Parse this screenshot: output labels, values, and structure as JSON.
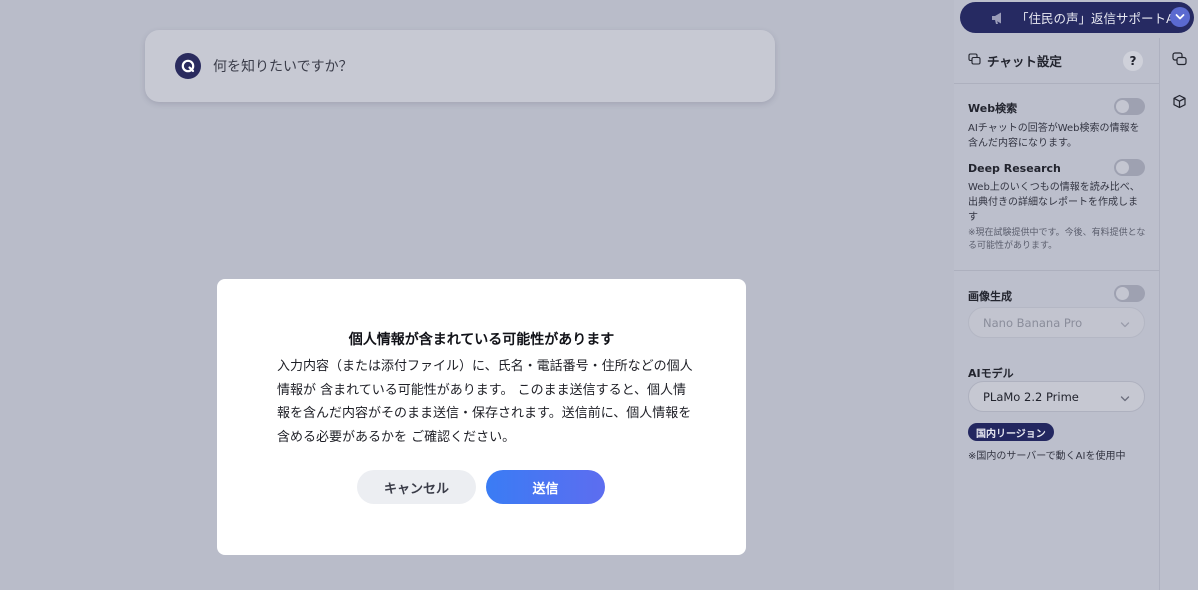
{
  "question_bar": {
    "placeholder": "何を知りたいですか？",
    "icon": "q-logo-icon"
  },
  "assistant": {
    "name": "「住民の声」返信サポートAI",
    "icon": "megaphone-icon",
    "chevron_icon": "chevron-down-icon"
  },
  "panel": {
    "title": "チャット設定",
    "title_icon": "chat-settings-icon",
    "help_label": "?",
    "side_icons": [
      "chat-bubbles-icon",
      "cube-icon"
    ],
    "web_search": {
      "label": "Web検索",
      "desc": "AIチャットの回答がWeb検索の情報を含んだ内容になります。",
      "enabled": false
    },
    "deep_research": {
      "label": "Deep Research",
      "desc": "Web上のいくつもの情報を読み比べ、出典付きの詳細なレポートを作成します",
      "note": "※現在試験提供中です。今後、有料提供となる可能性があります。",
      "enabled": false
    },
    "image_gen": {
      "label": "画像生成",
      "model": "Nano Banana Pro",
      "enabled": false
    },
    "ai_model": {
      "label": "AIモデル",
      "model": "PLaMo 2.2 Prime",
      "region_badge": "国内リージョン",
      "region_note": "※国内のサーバーで動くAIを使用中"
    }
  },
  "modal": {
    "title": "個人情報が含まれている可能性があります",
    "body": "入力内容（または添付ファイル）に、氏名・電話番号・住所などの個人情報が 含まれている可能性があります。 このまま送信すると、個人情報を含んだ内容がそのまま送信・保存されます。送信前に、個人情報を含める必要があるかを ご確認ください。",
    "cancel_label": "キャンセル",
    "send_label": "送信"
  },
  "colors": {
    "overlay": "#b9bcc9",
    "brand_navy": "#262a62",
    "send_gradient_start": "#3a7cf4",
    "send_gradient_end": "#5d6df0"
  }
}
